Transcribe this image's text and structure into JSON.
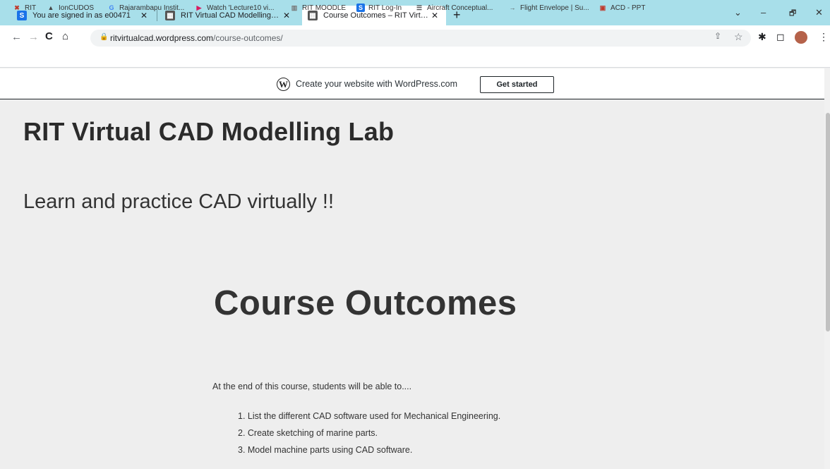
{
  "browser": {
    "tabs": [
      {
        "title": "You are signed in as e00471",
        "icon": "blue-s-icon"
      },
      {
        "title": "RIT Virtual CAD Modelling Lab -",
        "icon": "site-icon"
      },
      {
        "title": "Course Outcomes – RIT Virtual C",
        "icon": "site-icon",
        "active": true
      }
    ],
    "new_tab": "+",
    "window_controls": {
      "chevron": "⌄",
      "minimize": "–",
      "restore": "🗗",
      "close": "✕"
    },
    "url_host": "ritvirtualcad.wordpress.com",
    "url_path": "/course-outcomes/",
    "bookmarks": [
      {
        "label": "RIT",
        "icon": "rit-icon",
        "color": "#c0392b"
      },
      {
        "label": "IonCUDOS",
        "icon": "cap-icon",
        "color": "#444444"
      },
      {
        "label": "Rajarambapu Instit...",
        "icon": "google-icon",
        "color": "#4285f4"
      },
      {
        "label": "Watch 'Lecture10 vi...",
        "icon": "play-icon",
        "color": "#d81b60"
      },
      {
        "label": "RIT MOODLE",
        "icon": "moodle-icon",
        "color": "#777777"
      },
      {
        "label": "RIT Log-In",
        "icon": "blue-s-icon",
        "color": "#1a73e8"
      },
      {
        "label": "Aircraft Conceptual...",
        "icon": "book-icon",
        "color": "#555555"
      },
      {
        "label": "Flight Envelope | Su...",
        "icon": "plane-icon",
        "color": "#555555"
      },
      {
        "label": "ACD - PPT",
        "icon": "ppt-icon",
        "color": "#c0392b"
      }
    ]
  },
  "wp_banner": {
    "text": "Create your website with WordPress.com",
    "button": "Get started"
  },
  "site": {
    "title": "RIT Virtual CAD Modelling Lab",
    "tagline": "Learn and practice CAD virtually !!"
  },
  "page": {
    "heading": "Course Outcomes",
    "intro": "At the end of this course, students will be able to....",
    "outcomes": [
      "1. List the different CAD software used for Mechanical Engineering.",
      "2. Create sketching of marine parts.",
      "3. Model machine parts using CAD software."
    ]
  }
}
